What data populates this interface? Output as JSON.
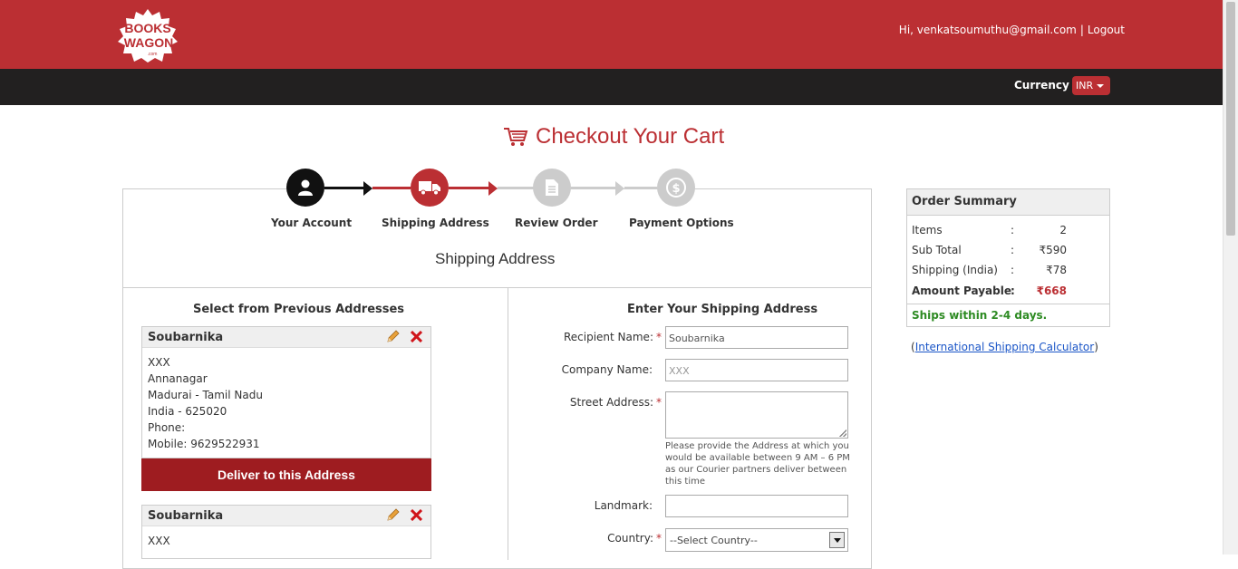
{
  "header": {
    "logo_text": "BOOKS WAGON",
    "greeting": "Hi, venkatsoumuthu@gmail.com",
    "separator": "|",
    "logout": "Logout"
  },
  "subheader": {
    "currency_label": "Currency",
    "currency_value": "INR"
  },
  "page": {
    "title": "Checkout Your Cart",
    "section_title": "Shipping Address"
  },
  "steps": [
    {
      "label": "Your Account",
      "icon": "user-icon",
      "state": "done"
    },
    {
      "label": "Shipping Address",
      "icon": "truck-icon",
      "state": "active"
    },
    {
      "label": "Review Order",
      "icon": "document-icon",
      "state": "pending"
    },
    {
      "label": "Payment Options",
      "icon": "dollar-icon",
      "state": "pending"
    }
  ],
  "previous": {
    "title": "Select from Previous Addresses",
    "addresses": [
      {
        "name": "Soubarnika",
        "line1": "XXX",
        "line2": "Annanagar",
        "line3": "Madurai - Tamil Nadu",
        "line4": "India - 625020",
        "phone": "Phone:",
        "mobile": "Mobile: 9629522931"
      },
      {
        "name": "Soubarnika",
        "line1": "XXX"
      }
    ],
    "deliver_label": "Deliver to this Address"
  },
  "form": {
    "title": "Enter Your Shipping Address",
    "recipient_label": "Recipient Name:",
    "recipient_value": "Soubarnika",
    "company_label": "Company Name:",
    "company_value": "XXX",
    "street_label": "Street Address:",
    "street_help": "Please provide the Address at which you would be available between 9 AM – 6 PM as our Courier partners deliver between this time",
    "landmark_label": "Landmark:",
    "country_label": "Country:",
    "country_value": "--Select Country--",
    "required_mark": "*"
  },
  "summary": {
    "title": "Order Summary",
    "rows": [
      {
        "label": "Items",
        "colon": ":",
        "value": "2"
      },
      {
        "label": "Sub Total",
        "colon": ":",
        "value": "₹590"
      },
      {
        "label": "Shipping (India)",
        "colon": ":",
        "value": "₹78"
      },
      {
        "label": "Amount Payable",
        "colon": ":",
        "value": "₹668"
      }
    ],
    "ships_note": "Ships within 2-4 days.",
    "calc_open": "(",
    "calc_link": "International Shipping Calculator",
    "calc_close": ")"
  },
  "colors": {
    "brand_red": "#bb2f33",
    "dark_bar": "#222020",
    "deliver_red": "#9e1c20",
    "ship_green": "#2e8b23",
    "link_blue": "#1a55c7"
  }
}
